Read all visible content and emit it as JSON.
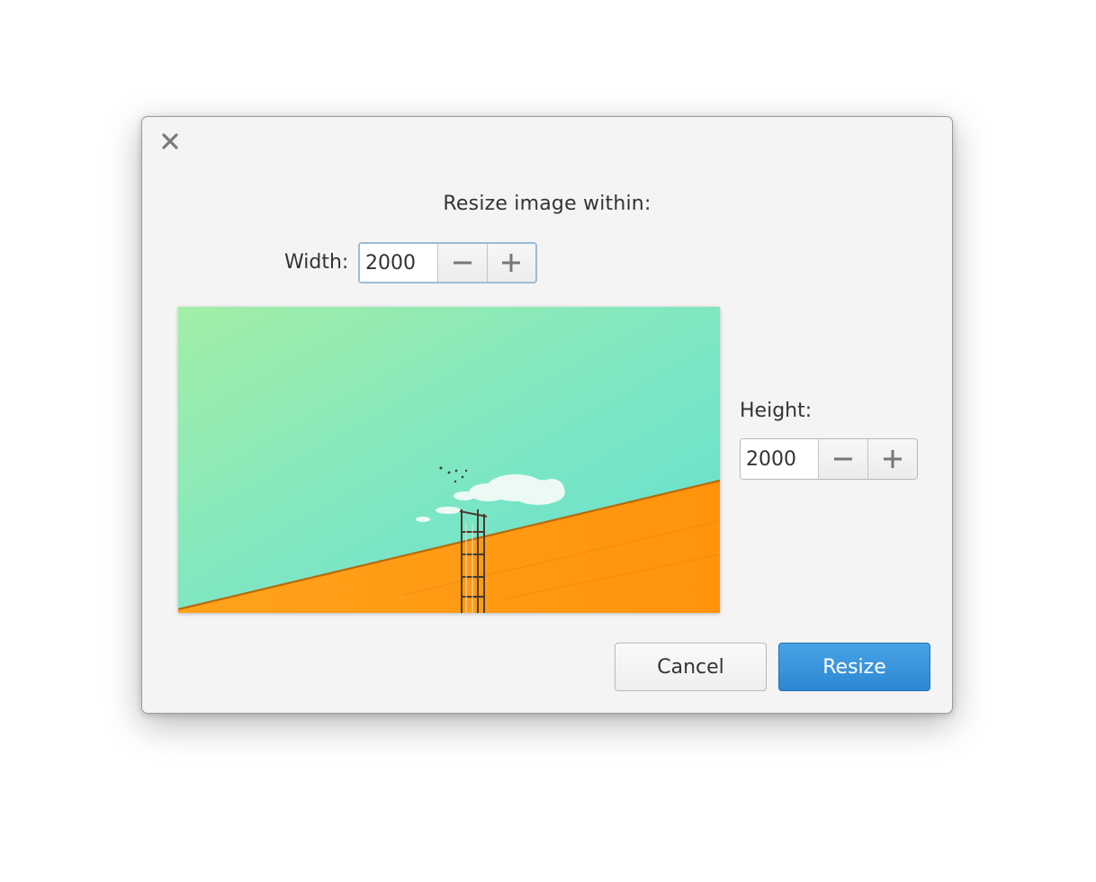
{
  "dialog": {
    "heading": "Resize image within:",
    "width": {
      "label": "Width:",
      "value": "2000"
    },
    "height": {
      "label": "Height:",
      "value": "2000"
    },
    "buttons": {
      "cancel": "Cancel",
      "resize": "Resize"
    },
    "icons": {
      "close": "close-icon",
      "decrease": "minus-icon",
      "increase": "plus-icon"
    }
  },
  "colors": {
    "accent": "#3a94dc",
    "dialog_bg": "#f4f4f4",
    "preview_sky": "#7de6c4",
    "preview_wall": "#ff9a14"
  }
}
